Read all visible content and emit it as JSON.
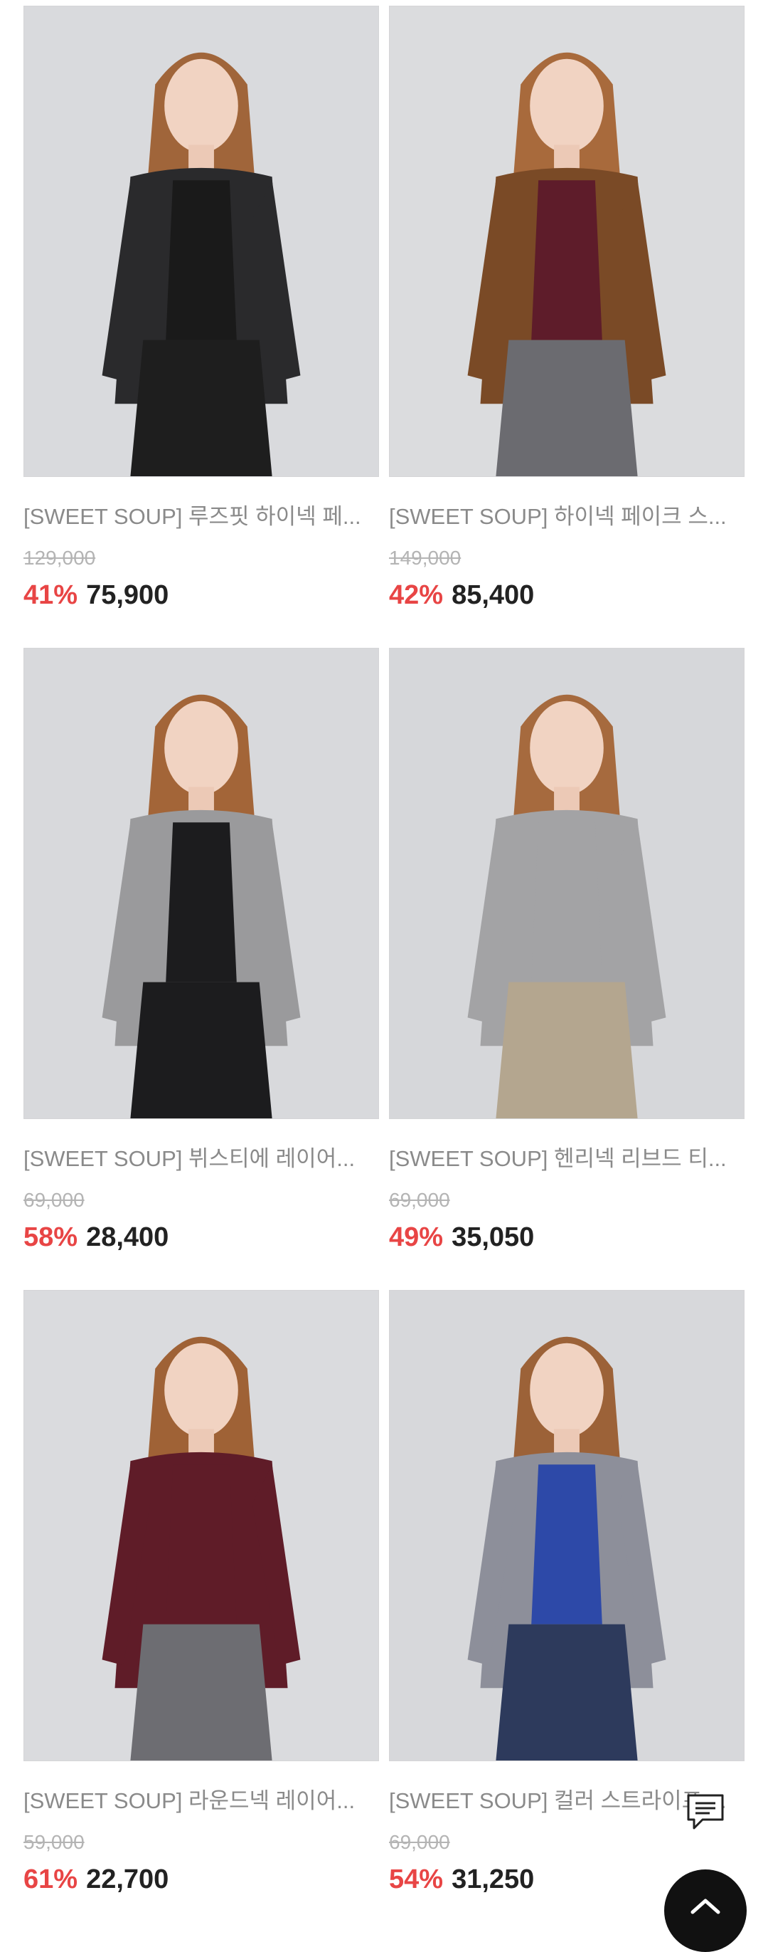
{
  "products": [
    {
      "title": "[SWEET SOUP] 루즈핏 하이넥 페...",
      "original_price": "129,000",
      "discount": "41%",
      "price": "75,900",
      "colors": {
        "bg": "#d9dadd",
        "top": "#2a2a2c",
        "inner": "#1a1a1a",
        "bottom": "#1e1e1e",
        "hair": "#a0653a"
      }
    },
    {
      "title": "[SWEET SOUP] 하이넥 페이크 스...",
      "original_price": "149,000",
      "discount": "42%",
      "price": "85,400",
      "colors": {
        "bg": "#dbdcde",
        "top": "#7a4a26",
        "inner": "#5e1c2a",
        "bottom": "#6b6b70",
        "hair": "#a86a3c"
      }
    },
    {
      "title": "[SWEET SOUP] 뷔스티에 레이어...",
      "original_price": "69,000",
      "discount": "58%",
      "price": "28,400",
      "colors": {
        "bg": "#d8d9dc",
        "top": "#9a9a9c",
        "inner": "#1c1c1e",
        "bottom": "#1c1c1e",
        "hair": "#a36538"
      }
    },
    {
      "title": "[SWEET SOUP] 헨리넥 리브드 티...",
      "original_price": "69,000",
      "discount": "49%",
      "price": "35,050",
      "colors": {
        "bg": "#d6d7da",
        "top": "#a3a3a5",
        "inner": "#a3a3a5",
        "bottom": "#b4a68f",
        "hair": "#a66a3e"
      }
    },
    {
      "title": "[SWEET SOUP] 라운드넥 레이어...",
      "original_price": "59,000",
      "discount": "61%",
      "price": "22,700",
      "colors": {
        "bg": "#dadbde",
        "top": "#5f1c28",
        "inner": "#5f1c28",
        "bottom": "#6d6d72",
        "hair": "#9f6236"
      }
    },
    {
      "title": "[SWEET SOUP] 컬러 스트라이프 ...",
      "original_price": "69,000",
      "discount": "54%",
      "price": "31,250",
      "colors": {
        "bg": "#d7d8db",
        "top": "#8d8f9a",
        "inner": "#2d49a8",
        "bottom": "#2d3a5c",
        "hair": "#9c6238"
      }
    }
  ],
  "buttons": {
    "chat_icon": "chat-icon",
    "scroll_top_icon": "chevron-up-icon"
  }
}
